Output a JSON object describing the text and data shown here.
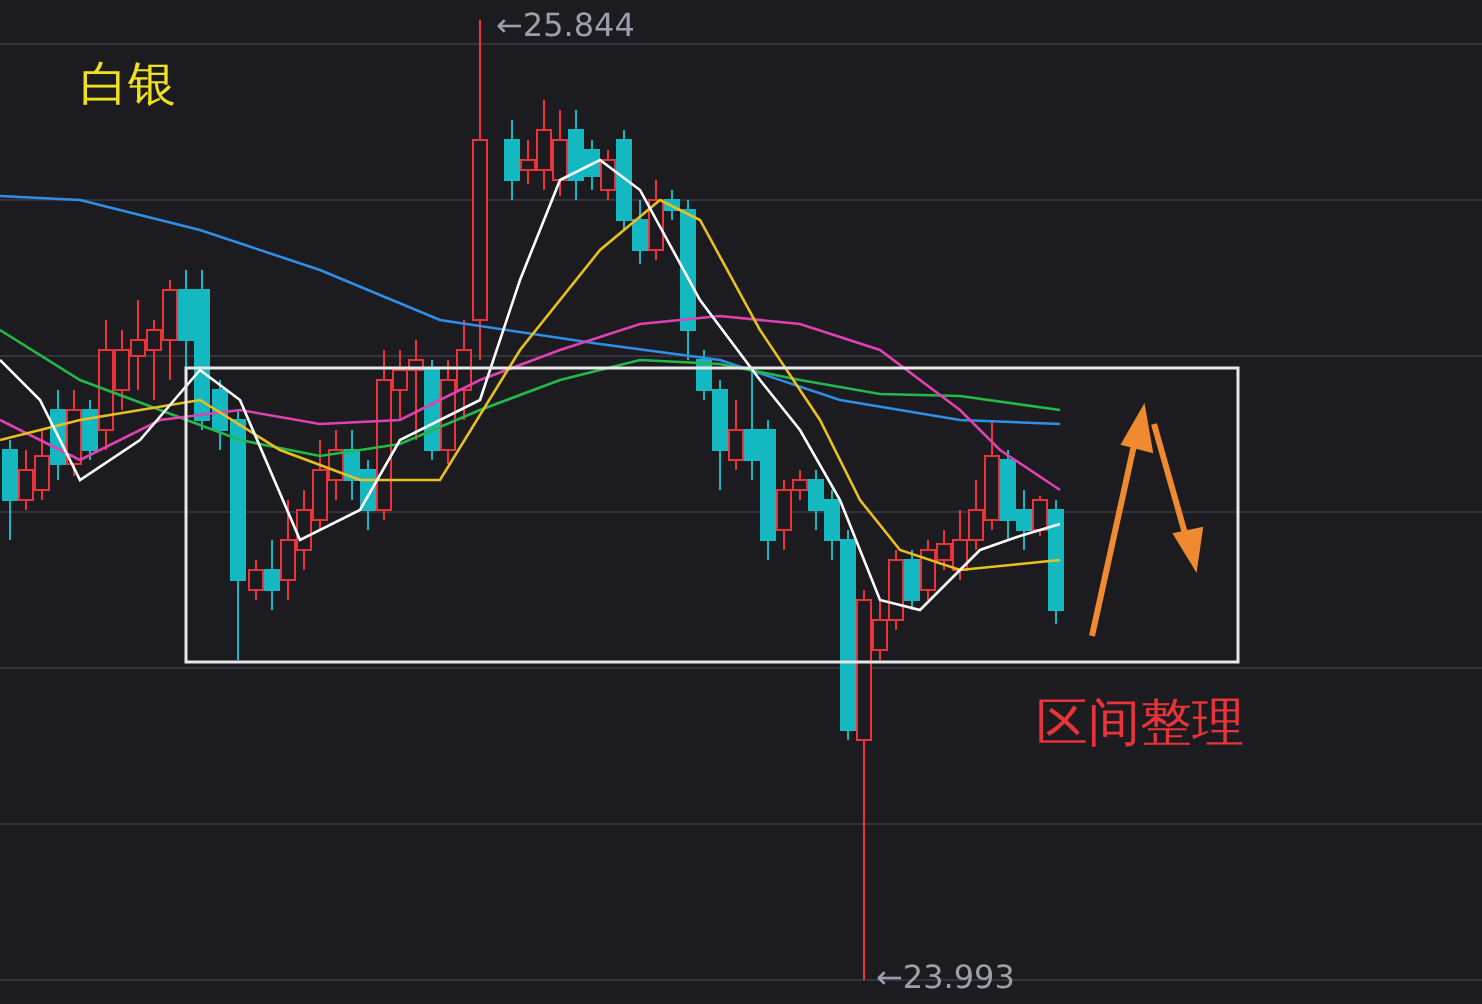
{
  "chart": {
    "title": "白银",
    "high_label": "←25.844",
    "low_label": "←23.993",
    "annotation": "区间整理"
  }
}
